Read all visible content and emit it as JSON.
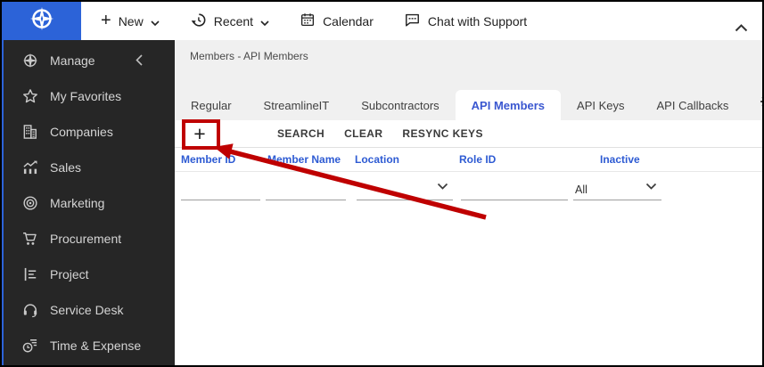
{
  "colors": {
    "logo_blue": "#2c63d8",
    "accent_blue": "#2e5bd3",
    "active_tab_blue": "#3a57d0",
    "annotation_red": "#bf0000",
    "sidebar_bg": "#262626",
    "strip_gray": "#f0f0f0"
  },
  "header": {
    "logo_icon": "compass-icon",
    "items": [
      {
        "label": "New",
        "icon": "plus-icon",
        "chevron": "chevron-down-icon"
      },
      {
        "label": "Recent",
        "icon": "history-icon",
        "chevron": "chevron-down-icon"
      },
      {
        "label": "Calendar",
        "icon": "calendar-icon"
      },
      {
        "label": "Chat with Support",
        "icon": "chat-icon"
      }
    ],
    "collapse_icon": "chevron-up-icon"
  },
  "sidebar": {
    "collapse_icon": "chevron-left-icon",
    "items": [
      {
        "label": "Manage",
        "icon": "compass-icon"
      },
      {
        "label": "My Favorites",
        "icon": "star-icon"
      },
      {
        "label": "Companies",
        "icon": "building-icon"
      },
      {
        "label": "Sales",
        "icon": "chart-icon"
      },
      {
        "label": "Marketing",
        "icon": "bullseye-icon"
      },
      {
        "label": "Procurement",
        "icon": "cart-icon"
      },
      {
        "label": "Project",
        "icon": "list-icon"
      },
      {
        "label": "Service Desk",
        "icon": "headset-icon"
      },
      {
        "label": "Time & Expense",
        "icon": "clock-list-icon"
      }
    ]
  },
  "breadcrumb": "Members - API Members",
  "tabs": {
    "items": [
      {
        "label": "Regular",
        "active": false
      },
      {
        "label": "StreamlineIT",
        "active": false
      },
      {
        "label": "Subcontractors",
        "active": false
      },
      {
        "label": "API Members",
        "active": true
      },
      {
        "label": "API Keys",
        "active": false
      },
      {
        "label": "API Callbacks",
        "active": false
      }
    ],
    "settings_icon": "gear-icon"
  },
  "toolbar": {
    "add_label": "+",
    "buttons": [
      {
        "label": "SEARCH"
      },
      {
        "label": "CLEAR"
      },
      {
        "label": "RESYNC KEYS"
      }
    ]
  },
  "grid": {
    "columns": [
      {
        "label": "Member ID"
      },
      {
        "label": "Member Name"
      },
      {
        "label": "Location"
      },
      {
        "label": "Role ID"
      },
      {
        "label": "Inactive"
      }
    ],
    "filters": [
      {
        "column": "Member ID",
        "type": "text",
        "value": ""
      },
      {
        "column": "Member Name",
        "type": "text",
        "value": ""
      },
      {
        "column": "Location",
        "type": "dropdown",
        "value": "",
        "icon": "chevron-down-icon"
      },
      {
        "column": "Role ID",
        "type": "text",
        "value": ""
      },
      {
        "column": "Inactive",
        "type": "dropdown",
        "value": "All",
        "icon": "chevron-down-icon"
      }
    ]
  },
  "annotation": {
    "type": "red-box-and-arrow",
    "target": "add-member-button"
  }
}
